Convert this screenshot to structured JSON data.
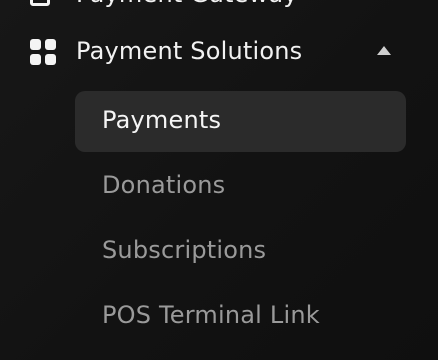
{
  "previous_item": {
    "icon": "document-icon",
    "label": "Payment Gateway"
  },
  "section": {
    "icon": "grid-icon",
    "label": "Payment Solutions",
    "expanded": true,
    "toggle_icon": "caret-up-icon"
  },
  "sub_items": [
    {
      "label": "Payments",
      "active": true
    },
    {
      "label": "Donations",
      "active": false
    },
    {
      "label": "Subscriptions",
      "active": false
    },
    {
      "label": "POS Terminal Link",
      "active": false
    }
  ],
  "colors": {
    "background": "#141414",
    "active_background": "#2b2b2b",
    "text_primary": "#f2f2f2",
    "text_secondary": "#9a9a9a"
  }
}
